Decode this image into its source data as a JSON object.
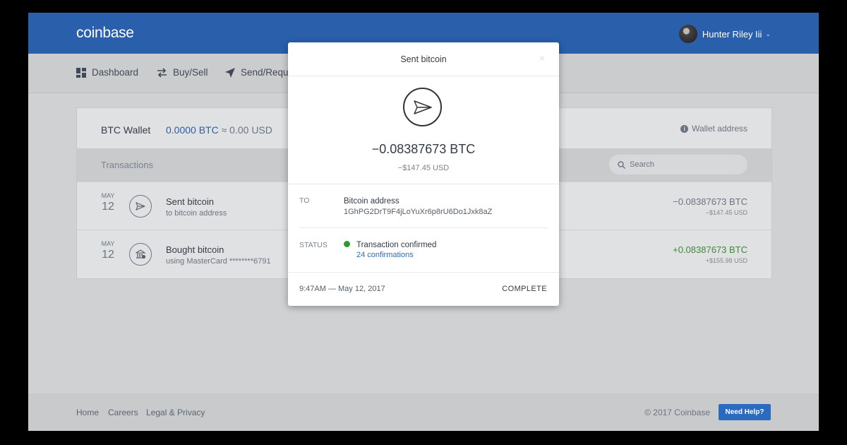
{
  "app": {
    "logo": "coinbase",
    "user": "Hunter Riley Iii"
  },
  "nav": [
    {
      "label": "Dashboard"
    },
    {
      "label": "Buy/Sell"
    },
    {
      "label": "Send/Requ"
    }
  ],
  "wallet": {
    "name": "BTC Wallet",
    "balance_btc": "0.0000 BTC",
    "balance_usd": "≈ 0.00 USD",
    "address_label": "Wallet address"
  },
  "transactions": {
    "title": "Transactions",
    "search_placeholder": "Search",
    "rows": [
      {
        "month": "MAY",
        "day": "12",
        "title": "Sent bitcoin",
        "subtitle": "to bitcoin address",
        "btc": "−0.08387673 BTC",
        "usd": "−$147.45 USD",
        "icon": "send-icon"
      },
      {
        "month": "MAY",
        "day": "12",
        "title": "Bought bitcoin",
        "subtitle": "using MasterCard ********6791",
        "btc": "+0.08387673 BTC",
        "usd": "+$155.98 USD",
        "icon": "bank-icon"
      }
    ]
  },
  "footer": {
    "links": [
      "Home",
      "Careers",
      "Legal & Privacy"
    ],
    "copyright": "© 2017 Coinbase",
    "help": "Need Help?"
  },
  "modal": {
    "title": "Sent bitcoin",
    "close": "×",
    "amount_btc": "−0.08387673 BTC",
    "amount_usd": "−$147.45 USD",
    "to_label": "TO",
    "to_title": "Bitcoin address",
    "to_address": "1GhPG2DrT9F4jLoYuXr6p8rU6Do1Jxk8aZ",
    "status_label": "STATUS",
    "status_title": "Transaction confirmed",
    "status_link": "24 confirmations",
    "time": "9:47AM — May 12, 2017",
    "state": "COMPLETE"
  },
  "colors": {
    "brand": "#2a5fab",
    "positive": "#3f8a3a",
    "confirmed": "#2a9c2a",
    "link": "#2a6bbf"
  }
}
